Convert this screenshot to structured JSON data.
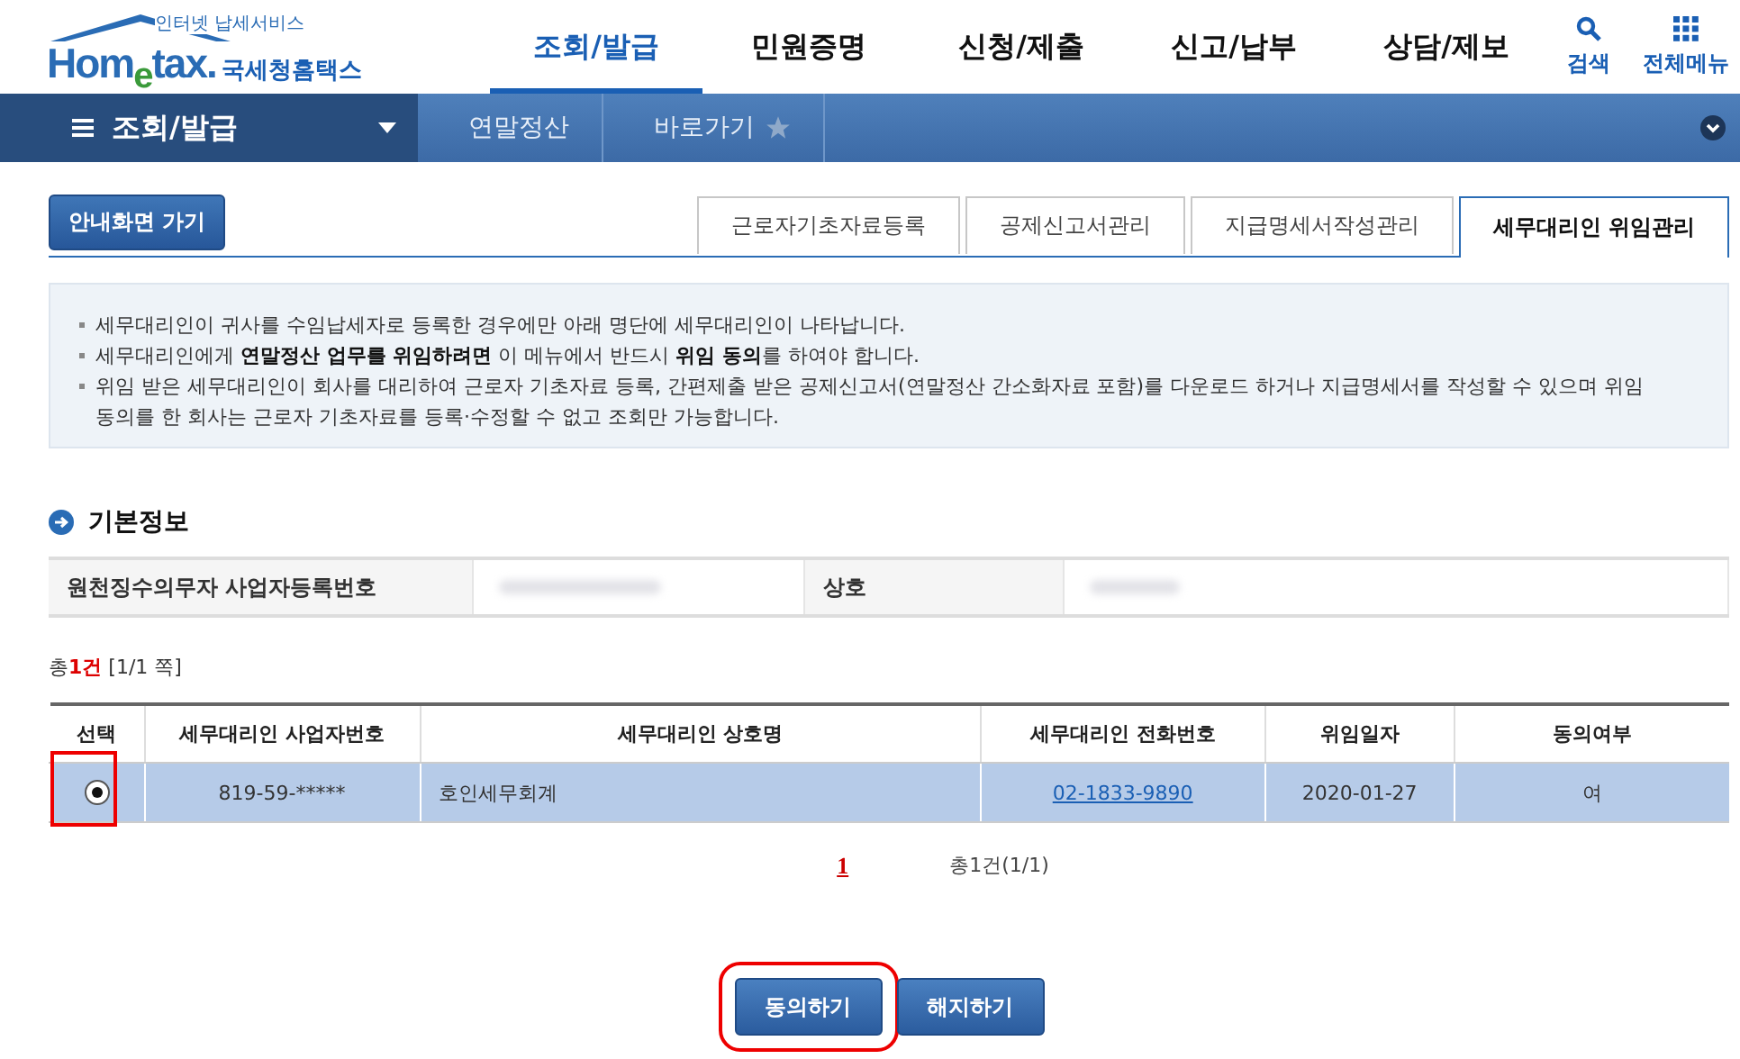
{
  "header": {
    "logo_caption": "인터넷 납세서비스",
    "logo_text": "Hom$_{e}$tax.",
    "logo_name": "국세청홈택스",
    "menu": [
      {
        "label": "조회/발급",
        "selected": true
      },
      {
        "label": "민원증명",
        "selected": false
      },
      {
        "label": "신청/제출",
        "selected": false
      },
      {
        "label": "신고/납부",
        "selected": false
      },
      {
        "label": "상담/제보",
        "selected": false
      }
    ],
    "tools": [
      {
        "kind": "search",
        "label": "검색"
      },
      {
        "kind": "grid",
        "label": "전체메뉴"
      }
    ]
  },
  "navbar": {
    "section": "조회/발급",
    "crumbs": [
      {
        "label": "연말정산",
        "kind": "plain"
      },
      {
        "label": "바로가기",
        "kind": "star"
      }
    ]
  },
  "guide_button": "안내화면 가기",
  "tabs": [
    {
      "label": "근로자기초자료등록",
      "selected": false
    },
    {
      "label": "공제신고서관리",
      "selected": false
    },
    {
      "label": "지급명세서작성관리",
      "selected": false
    },
    {
      "label": "세무대리인 위임관리",
      "selected": true
    }
  ],
  "notes": [
    "세무대리인이 귀사를 수임납세자로 등록한 경우에만 아래 명단에 세무대리인이 나타납니다.",
    "세무대리인에게 **연말정산 업무를 위임하려면** 이 메뉴에서 반드시 **위임 동의**를 하여야 합니다.",
    "위임 받은 세무대리인이 회사를 대리하여 근로자 기초자료 등록, 간편제출 받은 공제신고서(연말정산 간소화자료 포함)를 다운로드 하거나 지급명세서를 작성할 수 있으며 위임 동의를 한 회사는 근로자 기초자료를 등록·수정할 수 없고 조회만 가능합니다."
  ],
  "basic_info": {
    "title": "기본정보",
    "fields": [
      {
        "label": "원천징수의무자 사업자등록번호",
        "blurred": true
      },
      {
        "label": "상호",
        "blurred": true
      }
    ]
  },
  "count": "총**1건** [1/1 쪽]",
  "table": {
    "columns": [
      "선택",
      "세무대리인 사업자번호",
      "세무대리인 상호명",
      "세무대리인 전화번호",
      "위임일자",
      "동의여부"
    ],
    "rows": [
      {
        "selected": true,
        "highlighted": true,
        "cells": [
          "",
          "819-59-*****",
          "호인세무회계",
          "02-1833-9890",
          "2020-01-27",
          "여"
        ]
      }
    ]
  },
  "pagination": {
    "pages": [
      {
        "label": "1",
        "selected": true
      }
    ],
    "summary": "총1건(1/1)"
  },
  "buttons": [
    {
      "label": "동의하기",
      "highlighted": true
    },
    {
      "label": "해지하기",
      "highlighted": false
    }
  ]
}
